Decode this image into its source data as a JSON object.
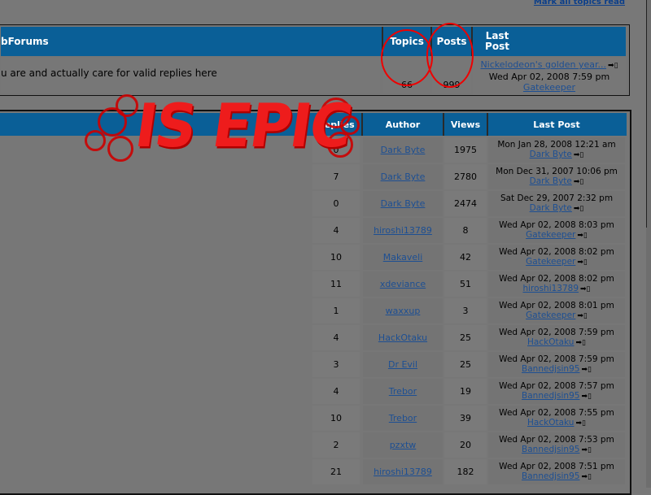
{
  "top_link": "Mark all topics read",
  "forum_table": {
    "headers": {
      "title": "bForums",
      "topics": "Topics",
      "posts": "Posts",
      "last_post": "Last Post"
    },
    "row": {
      "description": "u are and actually care for valid replies here",
      "topics": "66",
      "posts": "999",
      "last_post_title": "Nickelodeon's golden year...",
      "last_post_date": "Wed Apr 02, 2008 7:59 pm",
      "last_post_user": "Gatekeeper"
    }
  },
  "overlay_text": "IS EPIC",
  "topic_table": {
    "headers": {
      "replies": "Replies",
      "author": "Author",
      "views": "Views",
      "last_post": "Last Post"
    },
    "rows": [
      {
        "replies": "0",
        "author": "Dark Byte",
        "views": "1975",
        "date": "Mon Jan 28, 2008 12:21 am",
        "user": "Dark Byte"
      },
      {
        "replies": "7",
        "author": "Dark Byte",
        "views": "2780",
        "date": "Mon Dec 31, 2007 10:06 pm",
        "user": "Dark Byte"
      },
      {
        "replies": "0",
        "author": "Dark Byte",
        "views": "2474",
        "date": "Sat Dec 29, 2007 2:32 pm",
        "user": "Dark Byte"
      },
      {
        "replies": "4",
        "author": "hiroshi13789",
        "views": "8",
        "date": "Wed Apr 02, 2008 8:03 pm",
        "user": "Gatekeeper"
      },
      {
        "replies": "10",
        "author": "Makaveli",
        "views": "42",
        "date": "Wed Apr 02, 2008 8:02 pm",
        "user": "Gatekeeper"
      },
      {
        "replies": "11",
        "author": "xdeviance",
        "views": "51",
        "date": "Wed Apr 02, 2008 8:02 pm",
        "user": "hiroshi13789"
      },
      {
        "replies": "1",
        "author": "waxxup",
        "views": "3",
        "date": "Wed Apr 02, 2008 8:01 pm",
        "user": "Gatekeeper"
      },
      {
        "replies": "4",
        "author": "HackOtaku",
        "views": "25",
        "date": "Wed Apr 02, 2008 7:59 pm",
        "user": "HackOtaku"
      },
      {
        "replies": "3",
        "author": "Dr Evil",
        "views": "25",
        "date": "Wed Apr 02, 2008 7:59 pm",
        "user": "Bannedjsin95"
      },
      {
        "replies": "4",
        "author": "Trebor",
        "views": "19",
        "date": "Wed Apr 02, 2008 7:57 pm",
        "user": "Bannedjsin95"
      },
      {
        "replies": "10",
        "author": "Trebor",
        "views": "39",
        "date": "Wed Apr 02, 2008 7:55 pm",
        "user": "HackOtaku"
      },
      {
        "replies": "2",
        "author": "pzxtw",
        "views": "20",
        "date": "Wed Apr 02, 2008 7:53 pm",
        "user": "Bannedjsin95"
      },
      {
        "replies": "21",
        "author": "hiroshi13789",
        "views": "182",
        "date": "Wed Apr 02, 2008 7:51 pm",
        "user": "Bannedjsin95"
      }
    ]
  },
  "colors": {
    "header_bg": "#0a5f97",
    "page_bg": "#787878",
    "link": "#1d4f93",
    "annotation": "#ee1c1c"
  },
  "icons": {
    "goto_post": "goto-last-post-icon"
  }
}
